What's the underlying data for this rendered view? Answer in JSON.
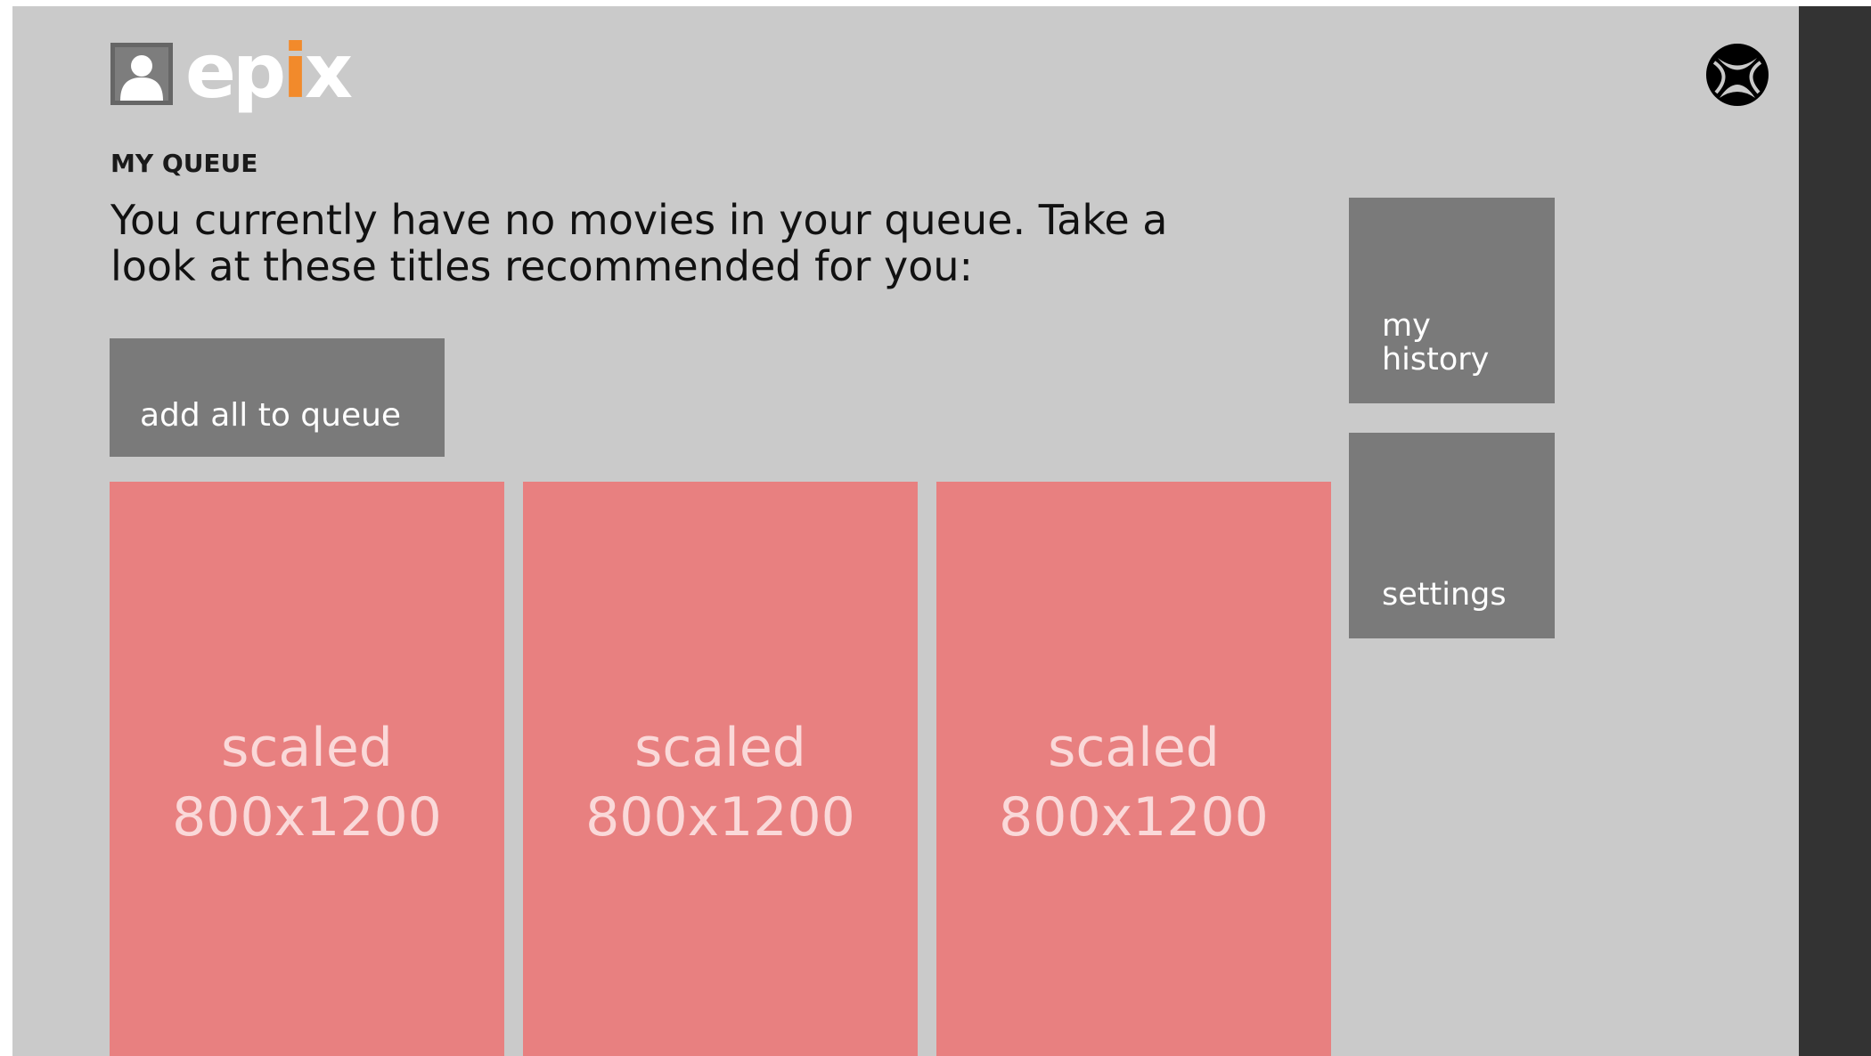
{
  "header": {
    "brand": {
      "part1": "ep",
      "accent": "i",
      "part2": "x"
    },
    "accent_color": "#f28a2b",
    "avatar_icon": "user-silhouette-icon",
    "console_icon": "xbox-logo-icon"
  },
  "queue": {
    "section_label": "MY QUEUE",
    "message_lines": [
      "You currently have no movies in your queue. Take a",
      "look at these titles recommended for you:"
    ],
    "add_all_label": "add all to queue"
  },
  "recommendations": [
    {
      "line1": "scaled",
      "line2": "800x1200"
    },
    {
      "line1": "scaled",
      "line2": "800x1200"
    },
    {
      "line1": "scaled",
      "line2": "800x1200"
    }
  ],
  "side_tiles": {
    "history": {
      "line1": "my",
      "line2": "history"
    },
    "settings": {
      "label": "settings"
    }
  },
  "colors": {
    "background": "#cacaca",
    "tile": "#7a7a7a",
    "poster_placeholder": "#e88080",
    "rail": "#333333"
  }
}
